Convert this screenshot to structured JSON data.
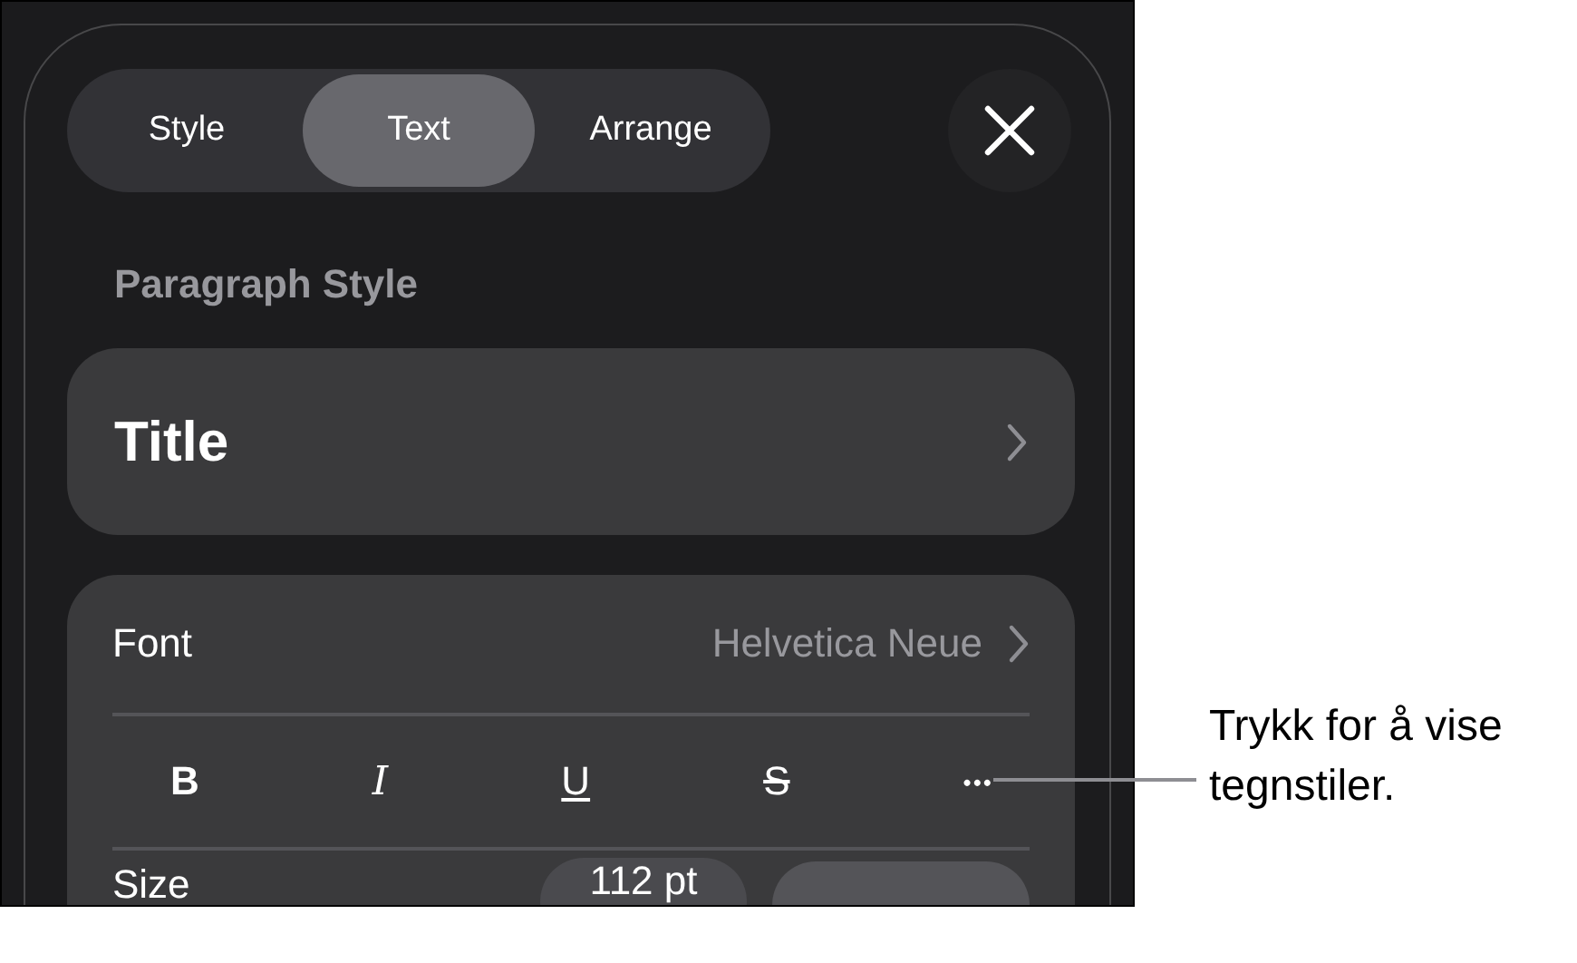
{
  "tabs": [
    {
      "label": "Style",
      "selected": false
    },
    {
      "label": "Text",
      "selected": true
    },
    {
      "label": "Arrange",
      "selected": false
    }
  ],
  "section_label": "Paragraph Style",
  "paragraph_style": {
    "value": "Title"
  },
  "font": {
    "label": "Font",
    "value": "Helvetica Neue"
  },
  "style_buttons": [
    {
      "label": "B",
      "kind": "bold"
    },
    {
      "label": "I",
      "kind": "italic"
    },
    {
      "label": "U",
      "kind": "underline"
    },
    {
      "label": "S",
      "kind": "strikethrough"
    },
    {
      "label": "•••",
      "kind": "more"
    }
  ],
  "size": {
    "label": "Size",
    "value": "112 pt"
  },
  "callout": "Trykk for å vise tegnstiler."
}
